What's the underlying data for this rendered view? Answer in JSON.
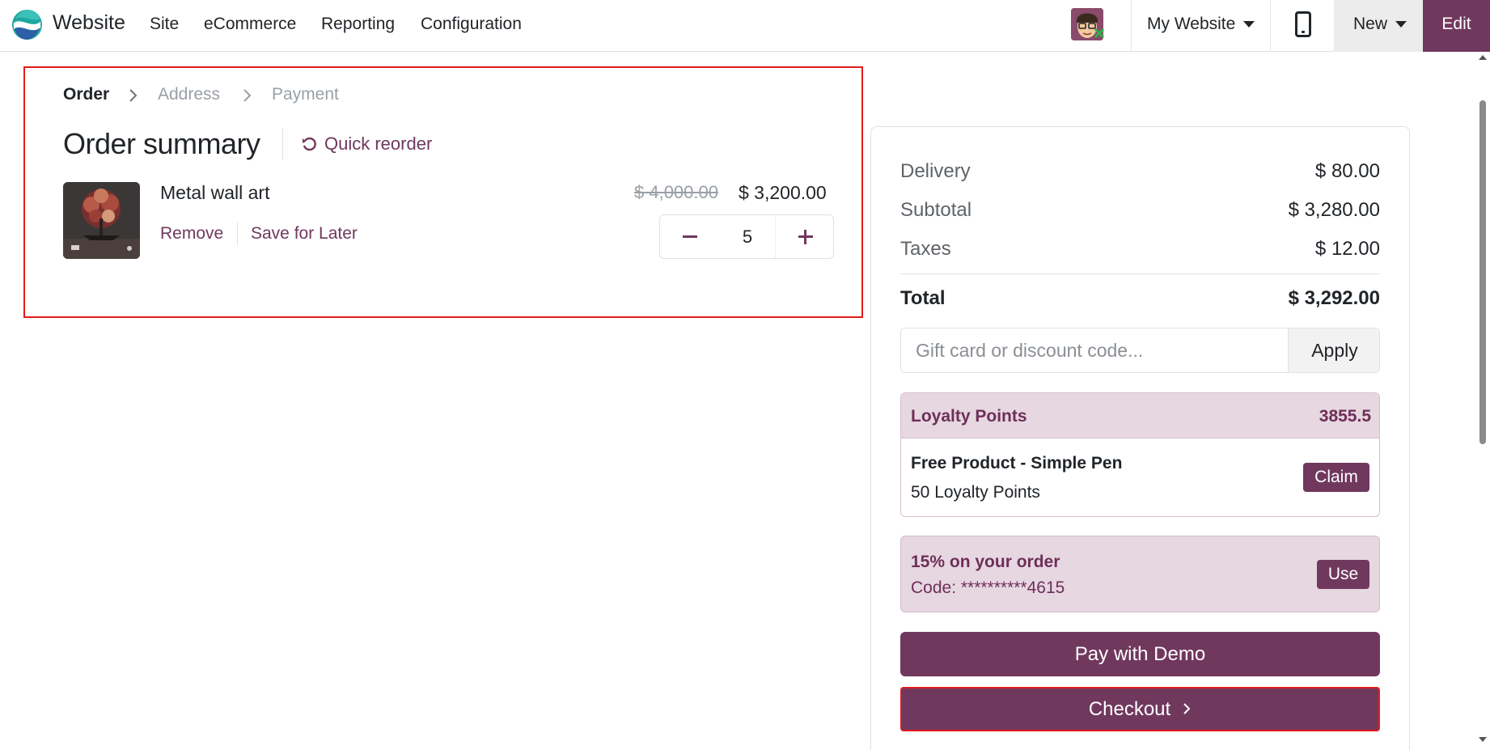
{
  "navbar": {
    "app_name": "Website",
    "menu": [
      "Site",
      "eCommerce",
      "Reporting",
      "Configuration"
    ],
    "site_selector": "My Website",
    "new_label": "New",
    "edit_label": "Edit"
  },
  "breadcrumb": {
    "steps": [
      "Order",
      "Address",
      "Payment"
    ],
    "active_step": "Order"
  },
  "order": {
    "title": "Order summary",
    "quick_reorder": "Quick reorder",
    "product": {
      "name": "Metal wall art",
      "old_price": "$ 4,000.00",
      "price": "$ 3,200.00",
      "quantity": "5",
      "remove_label": "Remove",
      "save_label": "Save for Later"
    }
  },
  "summary": {
    "delivery_label": "Delivery",
    "delivery_value": "$ 80.00",
    "subtotal_label": "Subtotal",
    "subtotal_value": "$ 3,280.00",
    "taxes_label": "Taxes",
    "taxes_value": "$ 12.00",
    "total_label": "Total",
    "total_value": "$ 3,292.00",
    "promo_placeholder": "Gift card or discount code...",
    "apply_label": "Apply",
    "loyalty": {
      "title": "Loyalty Points",
      "points": "3855.5",
      "reward_name": "Free Product - Simple Pen",
      "reward_cost": "50 Loyalty Points",
      "claim_label": "Claim"
    },
    "coupon": {
      "title": "15% on your order",
      "code": "Code: **********4615",
      "use_label": "Use"
    },
    "pay_label": "Pay with Demo",
    "checkout_label": "Checkout"
  },
  "colors": {
    "brand": "#71385e",
    "highlight_border": "#e21b1b"
  }
}
